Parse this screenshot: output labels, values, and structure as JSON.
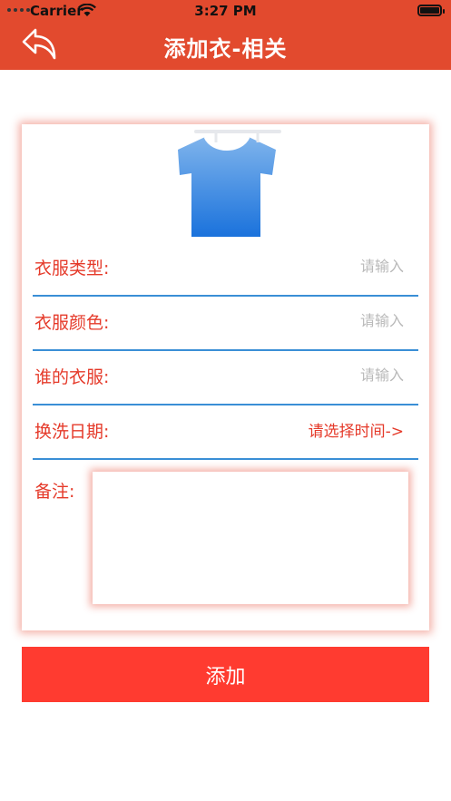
{
  "status_bar": {
    "carrier": "Carrier",
    "time": "3:27 PM"
  },
  "nav": {
    "title": "添加衣-相关",
    "back_icon": "back-arrow-icon"
  },
  "illustration": {
    "icon": "tshirt-icon",
    "colors": {
      "top": "#7fb4ec",
      "bottom": "#1a72dc",
      "hanger": "#e6e8ec"
    }
  },
  "form": {
    "clothing_type": {
      "label": "衣服类型:",
      "placeholder": "请输入"
    },
    "clothing_color": {
      "label": "衣服颜色:",
      "placeholder": "请输入"
    },
    "owner": {
      "label": "谁的衣服:",
      "placeholder": "请输入"
    },
    "wash_date": {
      "label": "换洗日期:",
      "picker_text": "请选择时间->"
    },
    "remark": {
      "label": "备注:",
      "value": ""
    }
  },
  "actions": {
    "add_label": "添加"
  },
  "colors": {
    "header": "#e24a2e",
    "accent_red": "#e53a2a",
    "button": "#ff3b30",
    "divider_blue": "#3a8fd6"
  }
}
